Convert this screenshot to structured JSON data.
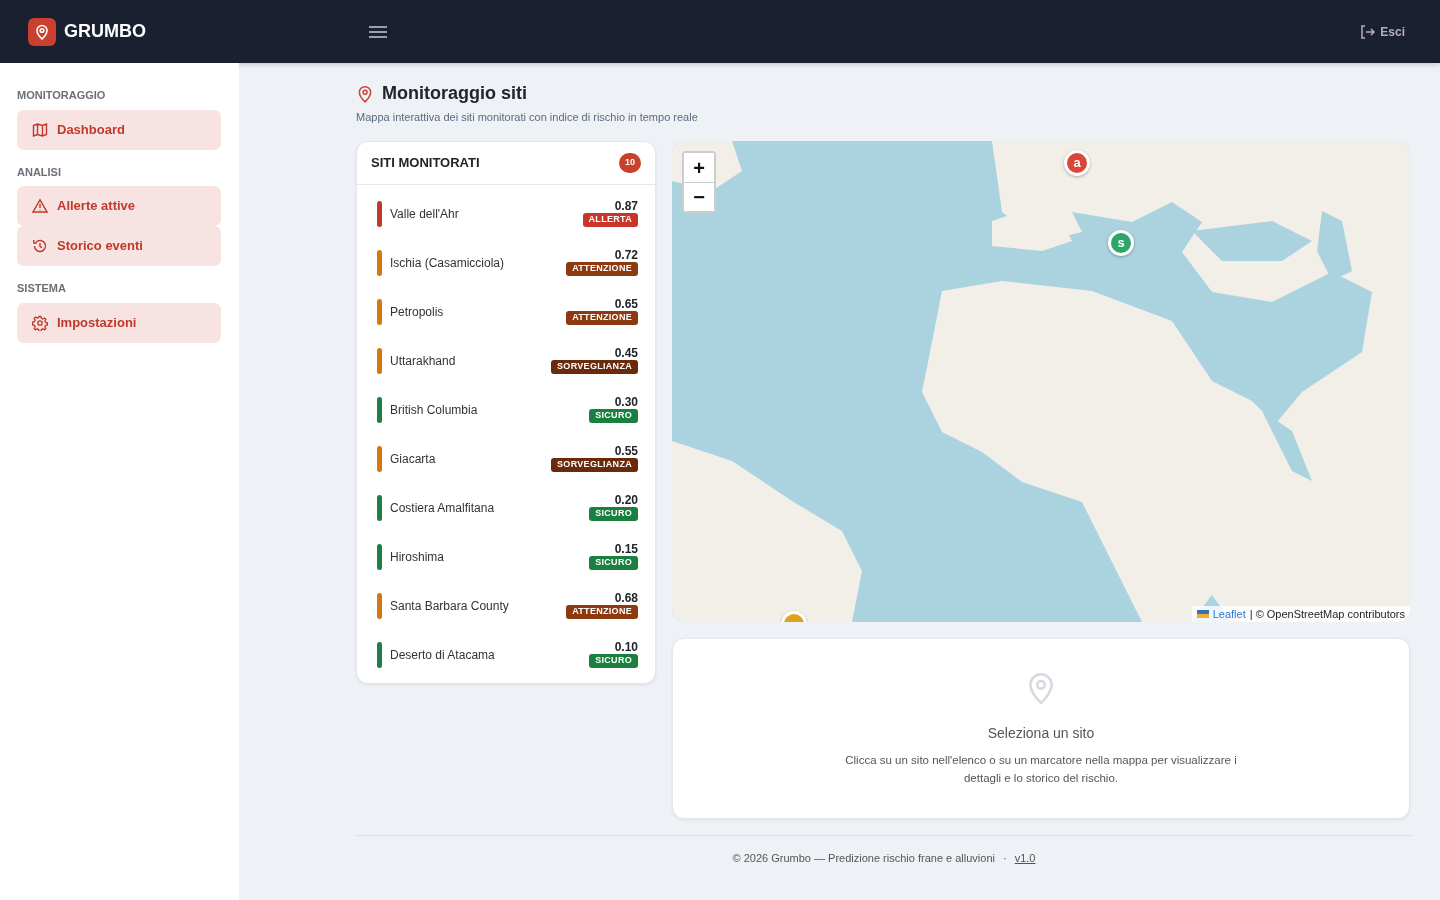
{
  "brand": {
    "name": "GRUMBO"
  },
  "navbar": {
    "logout": "Esci"
  },
  "sidebar": [
    {
      "heading": "MONITORAGGIO",
      "items": [
        {
          "label": "Dashboard"
        }
      ]
    },
    {
      "heading": "ANALISI",
      "items": [
        {
          "label": "Allerte attive"
        },
        {
          "label": "Storico eventi"
        }
      ]
    },
    {
      "heading": "SISTEMA",
      "items": [
        {
          "label": "Impostazioni"
        }
      ]
    }
  ],
  "page": {
    "title": "Monitoraggio siti",
    "subtitle": "Mappa interattiva dei siti monitorati con indice di rischio in tempo reale"
  },
  "sites_panel": {
    "title": "SITI MONITORATI",
    "count": "10",
    "sites": [
      {
        "name": "Valle dell'Ahr",
        "score": "0.87",
        "status": "ALLERTA",
        "kind": "allerta",
        "color": "#c0392b"
      },
      {
        "name": "Ischia (Casamicciola)",
        "score": "0.72",
        "status": "ATTENZIONE",
        "kind": "attenzione",
        "color": "#d4790f"
      },
      {
        "name": "Petropolis",
        "score": "0.65",
        "status": "ATTENZIONE",
        "kind": "attenzione",
        "color": "#d4790f"
      },
      {
        "name": "Uttarakhand",
        "score": "0.45",
        "status": "SORVEGLIANZA",
        "kind": "sorveglianza",
        "color": "#d4790f"
      },
      {
        "name": "British Columbia",
        "score": "0.30",
        "status": "SICURO",
        "kind": "sicuro",
        "color": "#1e7e45"
      },
      {
        "name": "Giacarta",
        "score": "0.55",
        "status": "SORVEGLIANZA",
        "kind": "sorveglianza",
        "color": "#d4790f"
      },
      {
        "name": "Costiera Amalfitana",
        "score": "0.20",
        "status": "SICURO",
        "kind": "sicuro",
        "color": "#1e7e45"
      },
      {
        "name": "Hiroshima",
        "score": "0.15",
        "status": "SICURO",
        "kind": "sicuro",
        "color": "#1e7e45"
      },
      {
        "name": "Santa Barbara County",
        "score": "0.68",
        "status": "ATTENZIONE",
        "kind": "attenzione",
        "color": "#d4790f"
      },
      {
        "name": "Deserto di Atacama",
        "score": "0.10",
        "status": "SICURO",
        "kind": "sicuro",
        "color": "#1e7e45"
      }
    ]
  },
  "map": {
    "kind": "picture",
    "zoom_in": "+",
    "zoom_out": "−",
    "markers": [
      {
        "label": "a",
        "color": "#d9473a"
      },
      {
        "label": "s",
        "color": "#2ea66a"
      },
      {
        "color": "#e0a020"
      }
    ],
    "attribution": {
      "link": "Leaflet",
      "text": "| © OpenStreetMap contributors"
    }
  },
  "detail": {
    "title": "Seleziona un sito",
    "text": "Clicca su un sito nell'elenco o su un marcatore nella mappa per visualizzare i dettagli e lo storico del rischio."
  },
  "footer": {
    "text": "© 2026 Grumbo — Predizione rischio frane e alluvioni",
    "separator": "·",
    "version": "v1.0"
  }
}
